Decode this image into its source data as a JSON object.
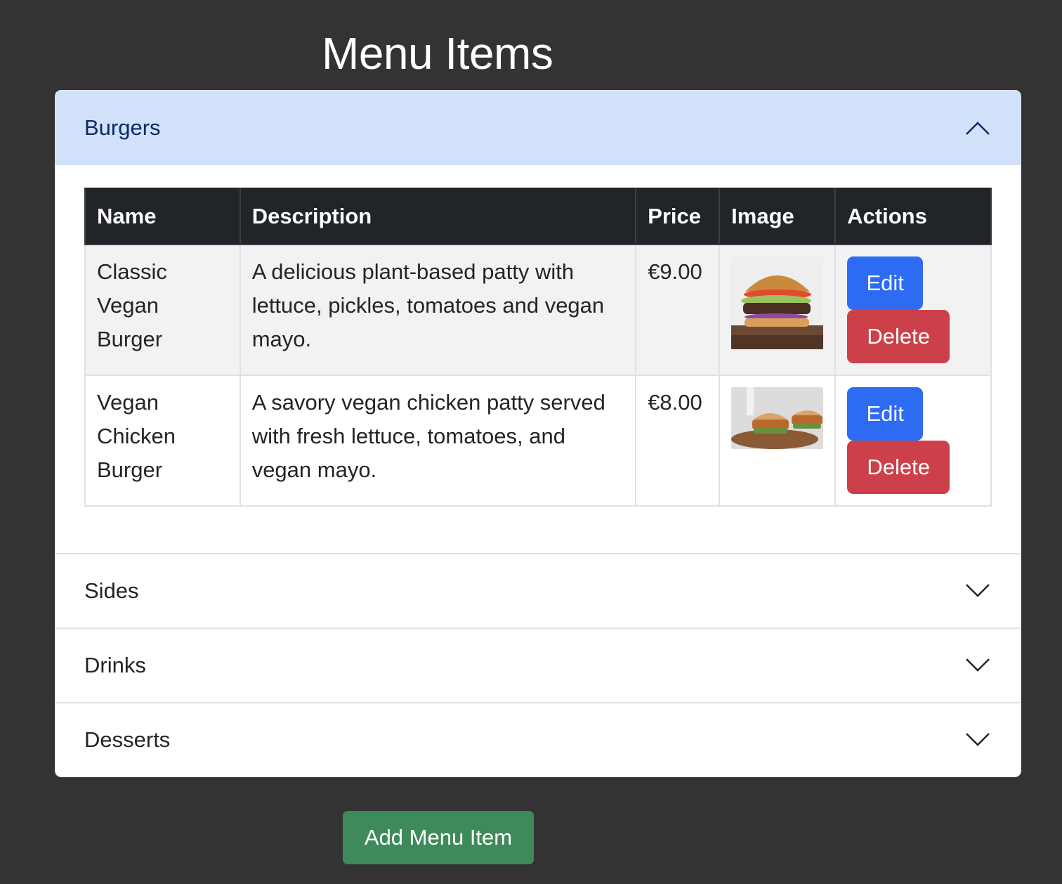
{
  "page_title": "Menu Items",
  "accordion": {
    "sections": [
      {
        "label": "Burgers",
        "expanded": true
      },
      {
        "label": "Sides",
        "expanded": false
      },
      {
        "label": "Drinks",
        "expanded": false
      },
      {
        "label": "Desserts",
        "expanded": false
      }
    ]
  },
  "table": {
    "headers": [
      "Name",
      "Description",
      "Price",
      "Image",
      "Actions"
    ],
    "rows": [
      {
        "name": "Classic Vegan Burger",
        "description": "A delicious plant-based patty with lettuce, pickles, tomatoes and vegan mayo.",
        "price": "€9.00",
        "image_icon": "burger-photo",
        "edit_label": "Edit",
        "delete_label": "Delete"
      },
      {
        "name": "Vegan Chicken Burger",
        "description": "A savory vegan chicken patty served with fresh lettuce, tomatoes, and vegan mayo.",
        "price": "€8.00",
        "image_icon": "chicken-burger-photo",
        "edit_label": "Edit",
        "delete_label": "Delete"
      }
    ]
  },
  "add_button_label": "Add Menu Item",
  "colors": {
    "background": "#333333",
    "open_header": "#d1e1fa",
    "table_header": "#212529",
    "edit": "#2d6cf2",
    "delete": "#cc4149",
    "add": "#3f8a5b"
  }
}
